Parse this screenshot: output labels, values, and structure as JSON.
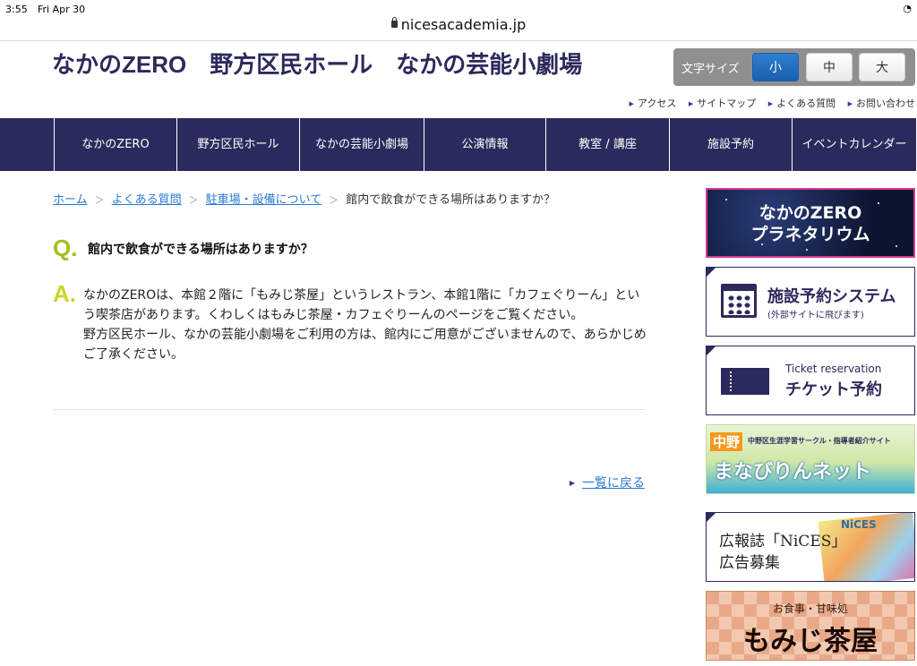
{
  "status": {
    "time": "3:55",
    "date": "Fri Apr 30",
    "wifi_icon": "wifi-icon"
  },
  "browser": {
    "url": "nicesacademia.jp"
  },
  "header": {
    "title": "なかのZERO　野方区民ホール　なかの芸能小劇場",
    "font_size_label": "文字サイズ",
    "font_sizes": [
      "小",
      "中",
      "大"
    ],
    "font_size_selected": "小",
    "utility_links": [
      "アクセス",
      "サイトマップ",
      "よくある質問",
      "お問い合わせ"
    ]
  },
  "nav": {
    "items": [
      "なかのZERO",
      "野方区民ホール",
      "なかの芸能小劇場",
      "公演情報",
      "教室 / 講座",
      "施設予約",
      "イベントカレンダー"
    ]
  },
  "breadcrumb": {
    "links": [
      "ホーム",
      "よくある質問",
      "駐車場・設備について"
    ],
    "current": "館内で飲食ができる場所はありますか？"
  },
  "qa": {
    "q_mark": "Q.",
    "question": "館内で飲食ができる場所はありますか？",
    "a_mark": "A.",
    "answer_lines": [
      "なかのZEROは、本館２階に「もみじ茶屋」というレストラン、本館1階に「カフェぐりーん」という喫茶店があります。くわしくはもみじ茶屋・カフェぐりーんのページをご覧ください。",
      "野方区民ホール、なかの芸能小劇場をご利用の方は、館内にご用意がございませんので、あらかじめご了承ください。"
    ],
    "back_link": "一覧に戻る"
  },
  "sidebar": {
    "planetarium": {
      "line1": "なかのZERO",
      "line2": "プラネタリウム"
    },
    "facility": {
      "title": "施設予約システム",
      "sub": "(外部サイトに飛びます)"
    },
    "ticket": {
      "en": "Ticket reservation",
      "jp": "チケット予約"
    },
    "manabi": {
      "badge": "中野",
      "tagline": "中野区生涯学習サークル・指導者紹介サイト",
      "title": "まなびりんネット"
    },
    "nices": {
      "line1": "広報誌「NiCES」",
      "line2": "広告募集",
      "mag": "NiCES"
    },
    "momiji": {
      "sub": "お食事・甘味処",
      "title": "もみじ茶屋"
    }
  },
  "colors": {
    "navy": "#2b2a5c",
    "link": "#2a7ad8",
    "q_green": "#9ec31d",
    "a_yellow": "#cdd42a",
    "accent_blue": "#1a5fae"
  }
}
